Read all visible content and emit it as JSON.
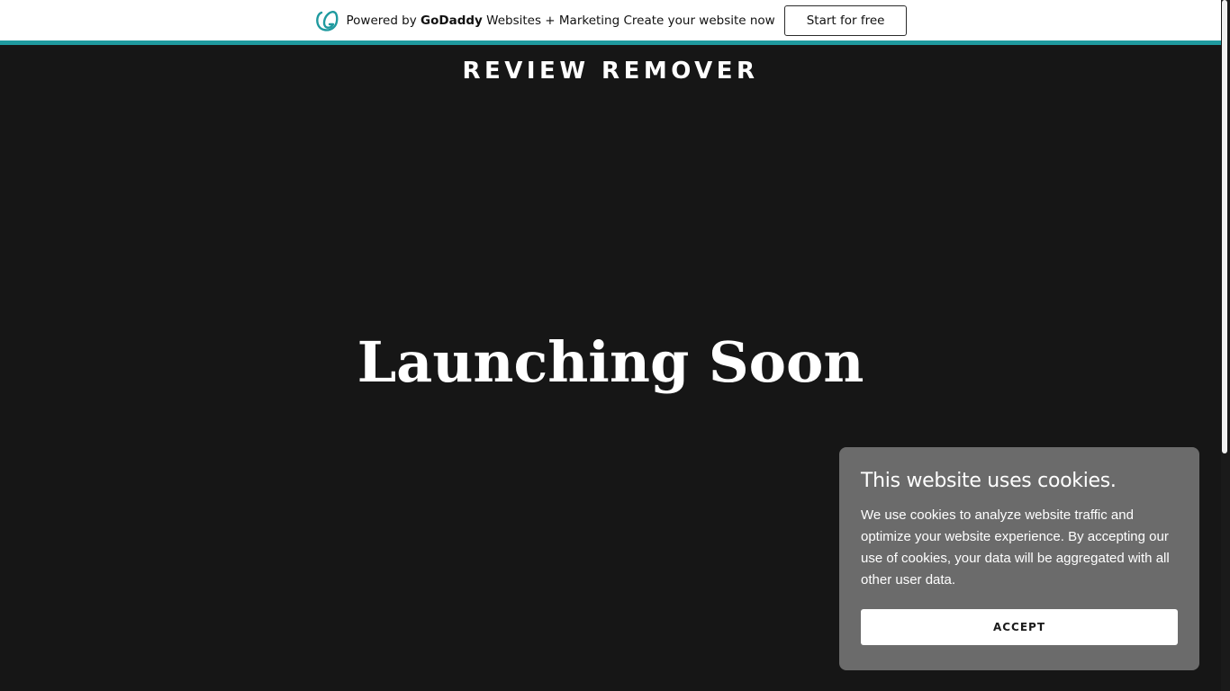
{
  "banner": {
    "logo_icon": "godaddy-logo-icon",
    "powered_by": "Powered by",
    "brand": "GoDaddy",
    "product": "Websites + Marketing",
    "cta_text": "Create your website now",
    "start_button": "Start for free",
    "accent_color": "#1f9a9f"
  },
  "site": {
    "title": "REVIEW REMOVER",
    "background": "#161616"
  },
  "hero": {
    "title": "Launching Soon"
  },
  "cookie_dialog": {
    "title": "This website uses cookies.",
    "body": "We use cookies to analyze website traffic and optimize your website experience. By accepting our use of cookies, your data will be aggregated with all other user data.",
    "accept_label": "ACCEPT",
    "background": "#6b6b6b"
  }
}
